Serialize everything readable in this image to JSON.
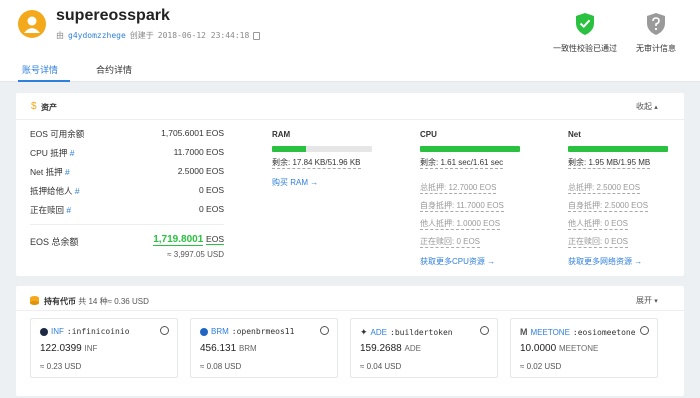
{
  "header": {
    "account_name": "supereosspark",
    "created_by_prefix": "由",
    "creator": "g4ydomzzhege",
    "created_mid": "创建于",
    "created_at": "2018-06-12 23:44:18"
  },
  "badges": [
    {
      "label": "一致性校验已通过",
      "icon": "shield-check",
      "color": "#29c13f"
    },
    {
      "label": "无审计信息",
      "icon": "shield-question",
      "color": "#9a9a9a"
    }
  ],
  "tabs": [
    {
      "label": "账号详情",
      "active": true
    },
    {
      "label": "合约详情",
      "active": false
    }
  ],
  "assets": {
    "title": "资产",
    "collapse_label": "收起",
    "rows": [
      {
        "label": "EOS 可用余额",
        "hash": "",
        "value": "1,705.6001 EOS"
      },
      {
        "label": "CPU 抵押",
        "hash": "#",
        "value": "11.7000 EOS"
      },
      {
        "label": "Net 抵押",
        "hash": "#",
        "value": "2.5000 EOS"
      },
      {
        "label": "抵押给他人",
        "hash": "#",
        "value": "0 EOS"
      },
      {
        "label": "正在赎回",
        "hash": "#",
        "value": "0 EOS"
      }
    ],
    "total_label": "EOS 总余额",
    "total_value": "1,719.8001",
    "total_unit": "EOS",
    "total_usd": "≈ 3,997.05 USD"
  },
  "resources": {
    "ram": {
      "title": "RAM",
      "remaining": "剩余: 17.84 KB/51.96 KB",
      "fill_fraction": 0.34,
      "buy": "购买 RAM →"
    },
    "cpu": {
      "title": "CPU",
      "remaining": "剩余: 1.61 sec/1.61 sec",
      "fill_fraction": 1.0,
      "lines": [
        "总抵押: 12.7000 EOS",
        "自身抵押: 11.7000 EOS",
        "他人抵押: 1.0000 EOS",
        "正在赎回: 0 EOS"
      ],
      "more": "获取更多CPU资源 →"
    },
    "net": {
      "title": "Net",
      "remaining": "剩余: 1.95 MB/1.95 MB",
      "fill_fraction": 1.0,
      "lines": [
        "总抵押: 2.5000 EOS",
        "自身抵押: 2.5000 EOS",
        "他人抵押: 0 EOS",
        "正在赎回: 0 EOS"
      ],
      "more": "获取更多网络资源 →"
    }
  },
  "tokens": {
    "title": "持有代币",
    "summary": "共 14 种≈ 0.36 USD",
    "expand_label": "展开",
    "items": [
      {
        "symbol": "INF",
        "contract": ":infinicoinio",
        "amount": "122.0399",
        "unit": "INF",
        "usd": "≈ 0.23 USD",
        "icon_color": "#1e2a44"
      },
      {
        "symbol": "BRM",
        "contract": ":openbrmeos11",
        "amount": "456.131",
        "unit": "BRM",
        "usd": "≈ 0.08 USD",
        "icon_color": "#2266c4"
      },
      {
        "symbol": "ADE",
        "contract": ":buildertoken",
        "amount": "159.2688",
        "unit": "ADE",
        "usd": "≈ 0.04 USD",
        "icon_color": "#333333"
      },
      {
        "symbol": "MEETONE",
        "contract": ":eosiomeetone",
        "amount": "10.0000",
        "unit": "MEETONE",
        "usd": "≈ 0.02 USD",
        "icon_color": "#555555"
      }
    ]
  }
}
